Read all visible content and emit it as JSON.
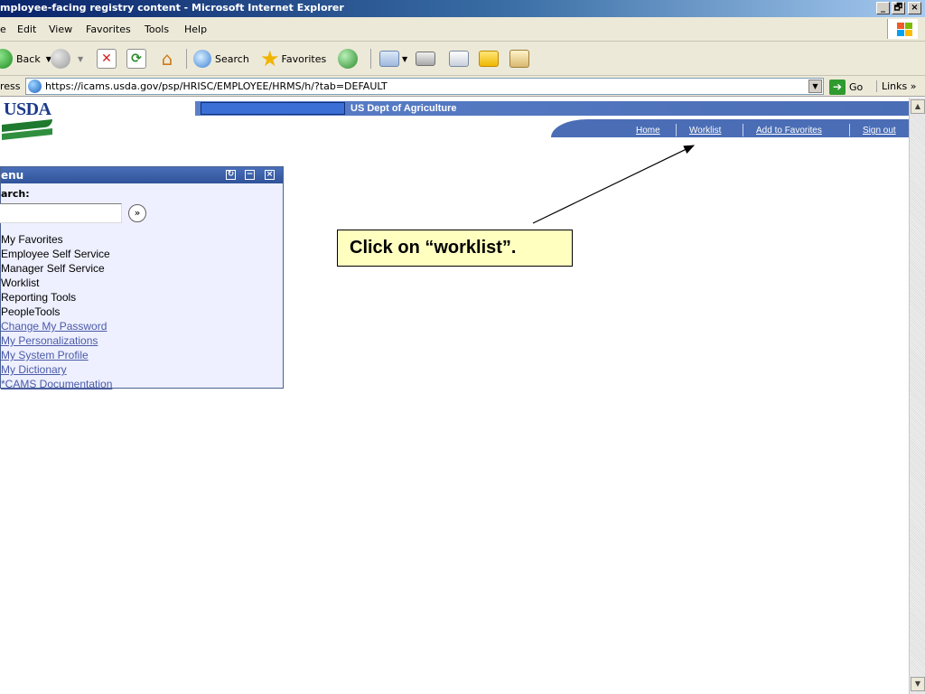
{
  "window": {
    "title": "mployee-facing registry content - Microsoft Internet Explorer",
    "minimize": "_",
    "maximize": "🗗",
    "close": "×"
  },
  "menubar": {
    "items": [
      "e",
      "Edit",
      "View",
      "Favorites",
      "Tools",
      "Help"
    ]
  },
  "toolbar": {
    "back": "Back",
    "search": "Search",
    "favorites": "Favorites"
  },
  "address": {
    "label": "ress",
    "url": "https://icams.usda.gov/psp/HRISC/EMPLOYEE/HRMS/h/?tab=DEFAULT",
    "go": "Go",
    "links": "Links »"
  },
  "header": {
    "logo": "USDA",
    "org": "US Dept of Agriculture",
    "nav": [
      "Home",
      "Worklist",
      "Add to Favorites",
      "Sign out"
    ]
  },
  "menu": {
    "title": "enu",
    "search_label": "arch:",
    "go_symbol": "»",
    "items": [
      "My Favorites",
      "Employee Self Service",
      "Manager Self Service",
      "Worklist",
      "Reporting Tools",
      "PeopleTools",
      "Change My Password",
      "My Personalizations",
      "My System Profile",
      "My Dictionary",
      "*CAMS Documentation"
    ],
    "item_texts": [
      "My Favorites",
      "Employee Self Service",
      "Manager Self Service",
      "Worklist",
      "Reporting Tools",
      "PeopleTools",
      "Change My Password",
      "My Personalizations",
      "My System Profile",
      "My Dictionary",
      "*CAMS Documentation"
    ]
  },
  "callout": {
    "text": "Click on “worklist”."
  },
  "colors": {
    "ie_title_blue": "#0a246a",
    "usda_blue": "#4a6db5",
    "usda_green": "#1f7a2f",
    "link_color": "#4a5aa8",
    "callout_bg": "#ffffc0"
  }
}
